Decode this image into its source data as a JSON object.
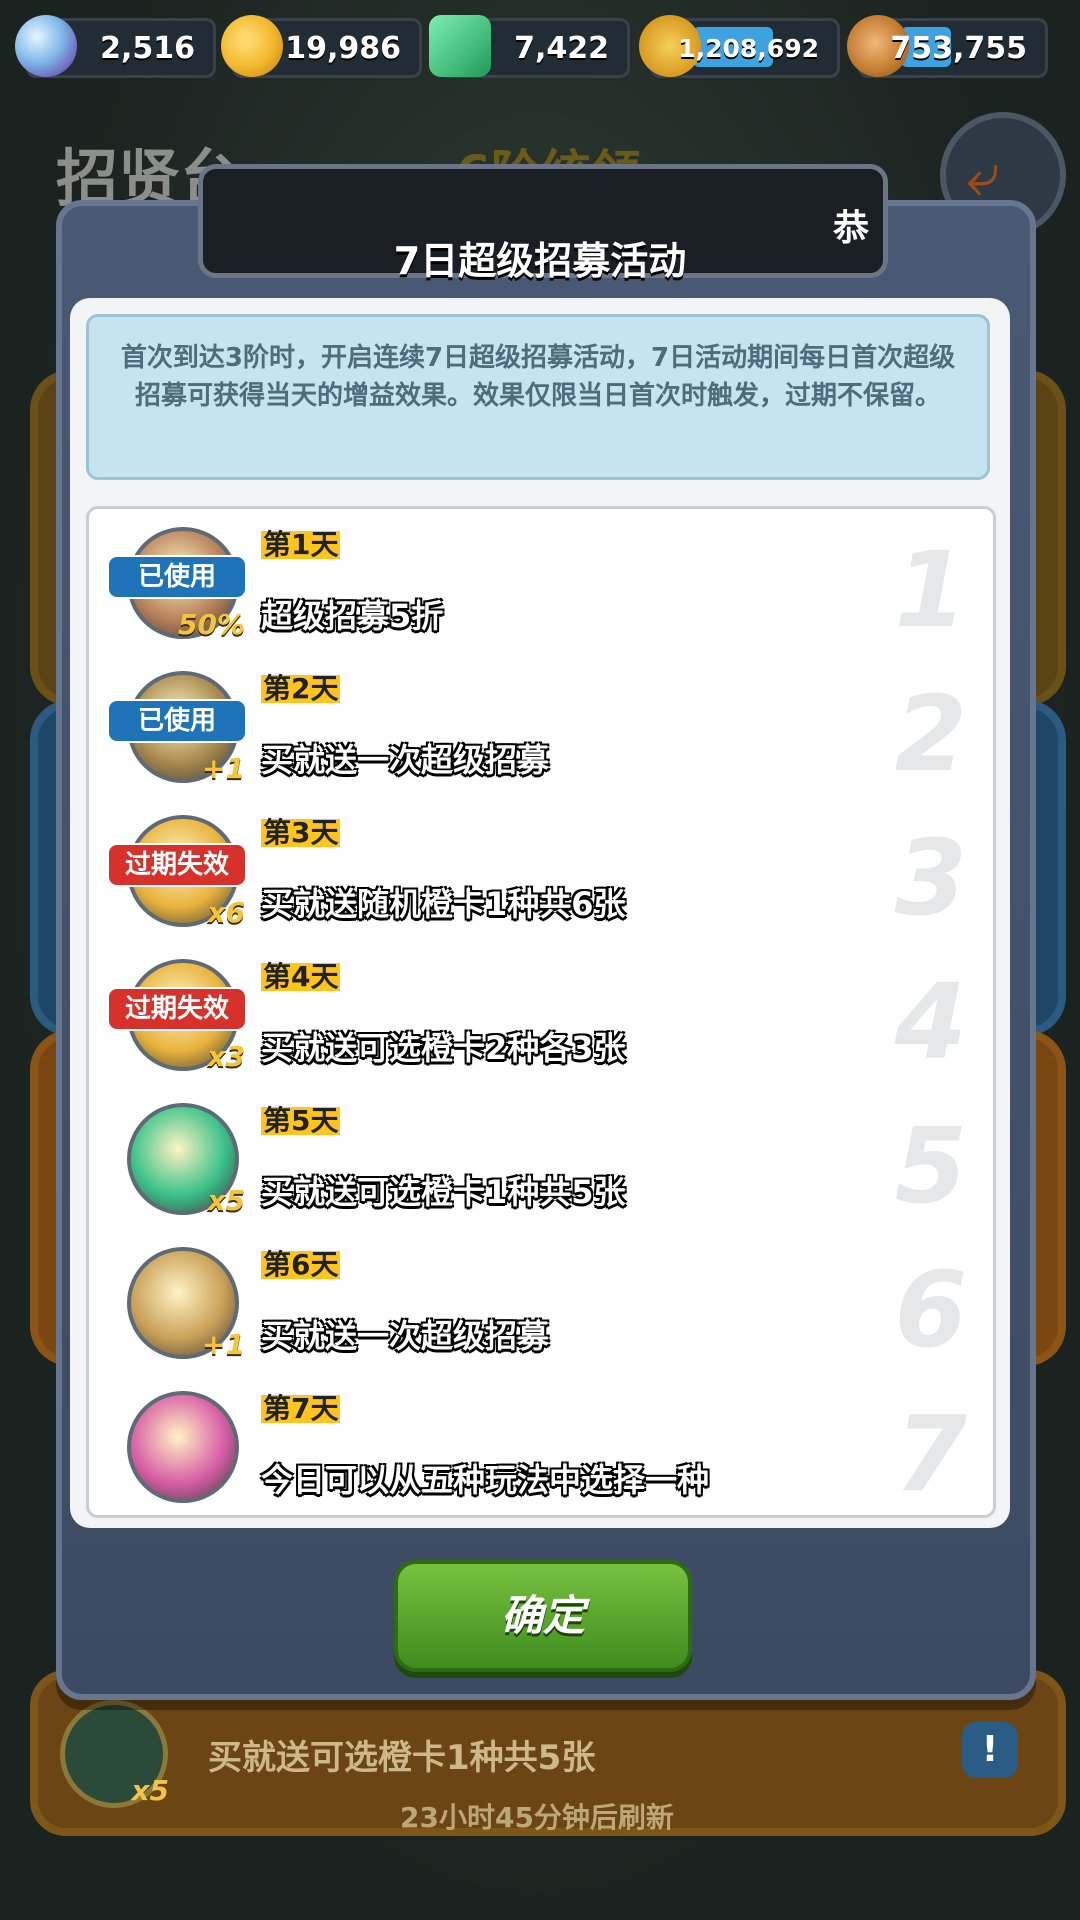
{
  "resources": [
    {
      "icon": "gem-icon",
      "value": "2,516",
      "color": "#8fd0ff"
    },
    {
      "icon": "gold-coin-icon",
      "value": "19,986",
      "color": "#f2b52b"
    },
    {
      "icon": "jade-token-icon",
      "value": "7,422",
      "color": "#36c27c"
    },
    {
      "icon": "wheat-icon",
      "value": "1,208,692",
      "color": "#e8b23a",
      "fill": 0.55
    },
    {
      "icon": "wood-log-icon",
      "value": "753,755",
      "color": "#c27a2e",
      "fill": 0.35
    }
  ],
  "header": {
    "title": "招贤台",
    "subtitle": "6阶统领"
  },
  "dialog": {
    "title": "7日超级招募活动",
    "title_overflow": "恭",
    "description": "首次到达3阶时，开启连续7日超级招募活动，7日活动期间每日首次超级招募可获得当天的增益效果。效果仅限当日首次时触发，过期不保留。",
    "days": [
      {
        "day": "第1天",
        "reward": "超级招募5折",
        "number": "1",
        "status": "已使用",
        "status_type": "used",
        "icon": "discount-card-icon",
        "mult": "50%",
        "icon_color": "#b9825a"
      },
      {
        "day": "第2天",
        "reward": "买就送一次超级招募",
        "number": "2",
        "status": "已使用",
        "status_type": "used",
        "icon": "general-portrait-icon",
        "mult": "+1",
        "icon_color": "#a88a4e"
      },
      {
        "day": "第3天",
        "reward": "买就送随机橙卡1种共6张",
        "number": "3",
        "status": "过期失效",
        "status_type": "expired",
        "icon": "orange-card-icon",
        "mult": "x6",
        "icon_color": "#e9b23c"
      },
      {
        "day": "第4天",
        "reward": "买就送可选橙卡2种各3张",
        "number": "4",
        "status": "过期失效",
        "status_type": "expired",
        "icon": "orange-card-icon",
        "mult": "x3",
        "icon_color": "#e9b23c"
      },
      {
        "day": "第5天",
        "reward": "买就送可选橙卡1种共5张",
        "number": "5",
        "status": "",
        "status_type": "",
        "icon": "jade-card-icon",
        "mult": "x5",
        "icon_color": "#3cc28a"
      },
      {
        "day": "第6天",
        "reward": "买就送一次超级招募",
        "number": "6",
        "status": "",
        "status_type": "",
        "icon": "general-portrait-icon",
        "mult": "+1",
        "icon_color": "#c9a058"
      },
      {
        "day": "第7天",
        "reward": "今日可以从五种玩法中选择一种",
        "number": "7",
        "status": "",
        "status_type": "",
        "icon": "choice-card-icon",
        "mult": "",
        "icon_color": "#d85fa6"
      }
    ],
    "confirm_label": "确定"
  },
  "background_card": {
    "reward": "买就送可选橙卡1种共5张",
    "mult": "x5",
    "info_label": "!",
    "refresh": "23小时45分钟后刷新"
  }
}
